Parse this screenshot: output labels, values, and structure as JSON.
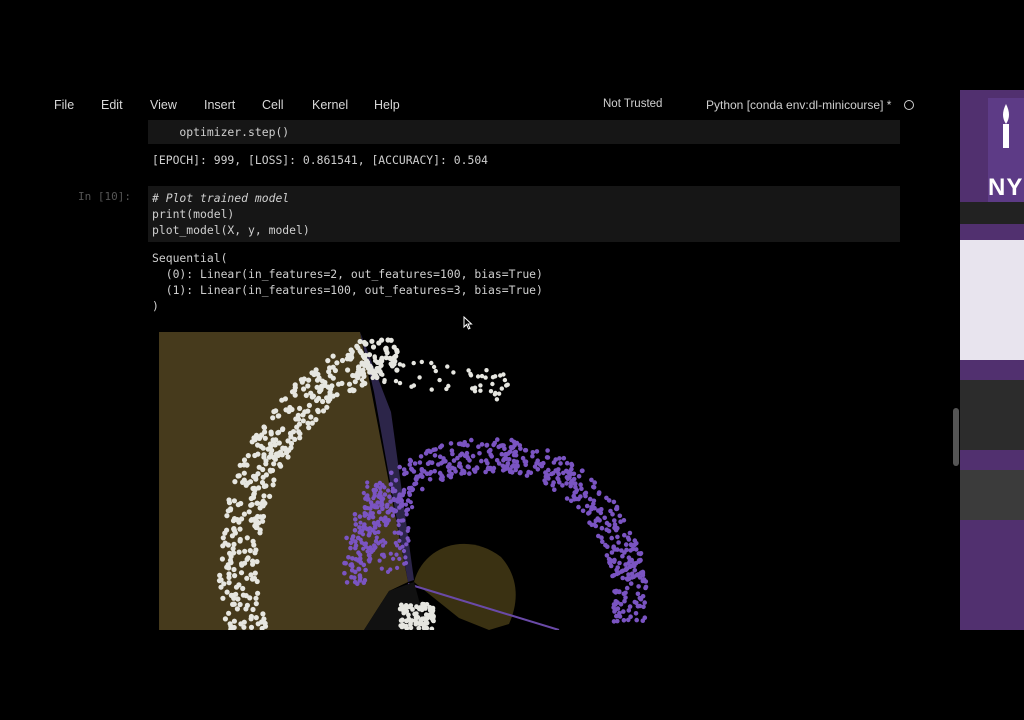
{
  "menu": [
    "File",
    "Edit",
    "View",
    "Insert",
    "Cell",
    "Kernel",
    "Help"
  ],
  "trust_status": "Not Trusted",
  "kernel": "Python [conda env:dl-minicourse] *",
  "cell_prev": {
    "code_tail": "    optimizer.step()",
    "output": "[EPOCH]: 999, [LOSS]: 0.861541, [ACCURACY]: 0.504"
  },
  "cell10": {
    "prompt": "In [10]:",
    "code": [
      "# Plot trained model",
      "print(model)",
      "plot_model(X, y, model)"
    ],
    "output": [
      "Sequential(",
      "  (0): Linear(in_features=2, out_features=100, bias=True)",
      "  (1): Linear(in_features=100, out_features=3, bias=True)",
      ")"
    ]
  },
  "logo_text": "NY",
  "colors": {
    "background": "#000000",
    "region_olive": "#463a1c",
    "purple_class": "#7a54c2",
    "white_class": "#e6e6e0",
    "nyu_violet": "#57068c"
  }
}
